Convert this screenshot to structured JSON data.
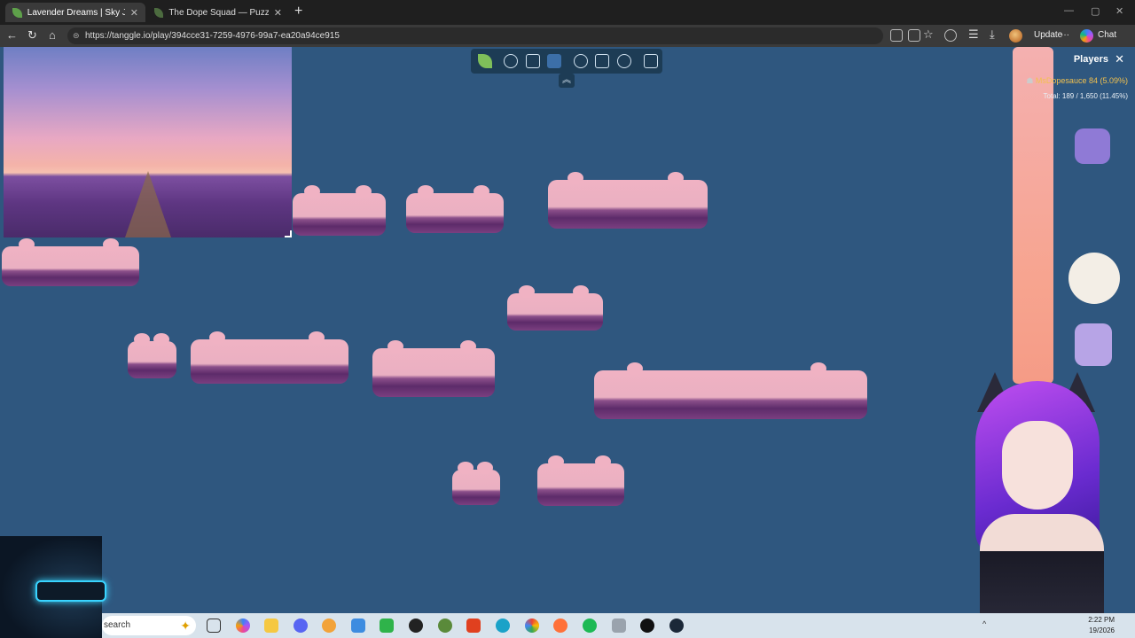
{
  "browser": {
    "tabs": [
      {
        "label": "Lavender Dreams | Sky Jigsaw",
        "active": true
      },
      {
        "label": "The Dope Squad — Puzzles",
        "active": false
      }
    ],
    "url": "https://tanggle.io/play/394cce31-7259-4976-99a7-ea20a94ce915",
    "update_label": "Update",
    "chat_label": "Chat"
  },
  "game": {
    "toolbar_icons": [
      "leaf-logo-icon",
      "puzzle-piece-icon",
      "image-icon",
      "background-color-icon",
      "players-icon",
      "share-icon",
      "settings-icon",
      "fullscreen-icon"
    ],
    "background_color": "#2f577f",
    "players_panel": {
      "title": "Players",
      "player_name": "MsDopesauce",
      "player_stats": "84 (5.09%)",
      "total": "Total: 189 / 1,650 (11.45%)"
    }
  },
  "taskbar": {
    "search_placeholder": "search",
    "apps": [
      "widgets-icon",
      "copilot-icon",
      "file-explorer-icon",
      "discord-icon",
      "app-icon",
      "kodi-icon",
      "h-app-icon",
      "obs-icon",
      "app-icon-2",
      "brave-icon",
      "edge-icon",
      "chrome-icon",
      "firefox-icon",
      "spotify-icon",
      "app-icon-3",
      "app-icon-4",
      "steam-icon"
    ],
    "time": "2:22 PM",
    "date": "19/2026"
  }
}
